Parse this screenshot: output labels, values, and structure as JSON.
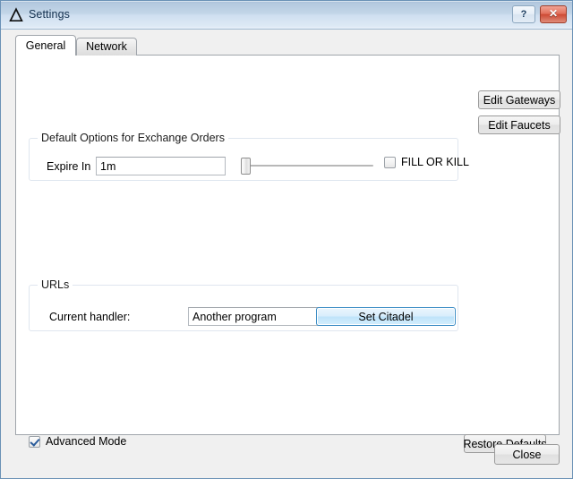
{
  "window": {
    "title": "Settings",
    "app_icon": "delta-triangle-icon",
    "controls": {
      "help_label": "?",
      "close_label": "✕"
    }
  },
  "tabs": [
    {
      "id": "general",
      "label": "General",
      "active": true
    },
    {
      "id": "network",
      "label": "Network",
      "active": false
    }
  ],
  "general_tab": {
    "buttons": {
      "edit_gateways": "Edit Gateways",
      "edit_faucets": "Edit Faucets",
      "restore_defaults": "Restore Defaults"
    },
    "default_options_group": {
      "title": "Default Options for Exchange Orders",
      "expire_in_label": "Expire In",
      "expire_in_value": "1m",
      "expire_in_placeholder": "",
      "slider": {
        "value": 0,
        "min": 0,
        "max": 100
      },
      "fill_or_kill_label": "FILL OR KILL",
      "fill_or_kill_checked": false
    },
    "urls_group": {
      "title": "URLs",
      "current_handler_label": "Current handler:",
      "current_handler_value": "Another program",
      "current_handler_placeholder": "",
      "set_citadel_label": "Set Citadel"
    },
    "advanced_mode_label": "Advanced Mode",
    "advanced_mode_checked": true
  },
  "footer": {
    "close_label": "Close"
  },
  "colors": {
    "titlebar_top": "#a8c0da",
    "titlebar_bottom": "#e9f0f8",
    "dialog_bg": "#f0f0f0",
    "panel_bg": "#ffffff",
    "window_border": "#6a91b6",
    "close_button_red": "#cd4a34",
    "default_button_blue": "#3c8dc5",
    "group_border": "#dfe6ef"
  }
}
